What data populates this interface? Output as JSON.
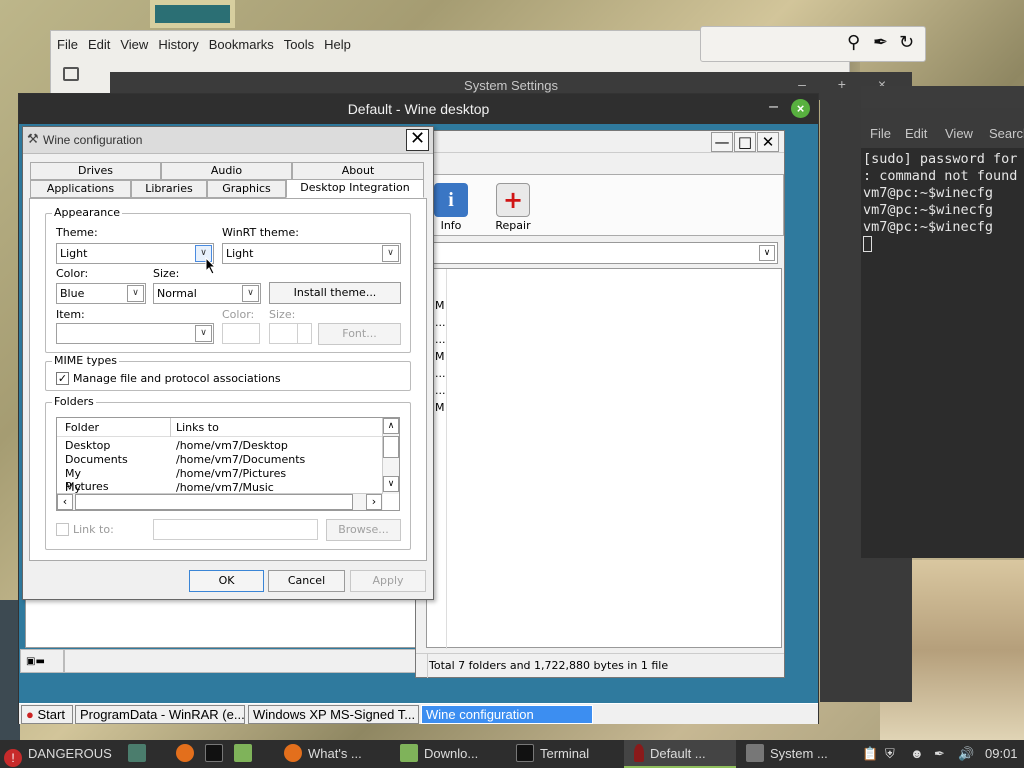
{
  "firefox": {
    "menu": [
      "File",
      "Edit",
      "View",
      "History",
      "Bookmarks",
      "Tools",
      "Help"
    ]
  },
  "system_settings": {
    "title": "System Settings"
  },
  "terminal": {
    "menu": [
      "File",
      "Edit",
      "View",
      "Search"
    ],
    "lines": [
      "[sudo] password for",
      ": command not found",
      "vm7@pc:~$winecfg",
      "vm7@pc:~$winecfg",
      "vm7@pc:~$winecfg"
    ]
  },
  "wine_desktop": {
    "title": "Default - Wine desktop",
    "close_icon": "×",
    "minimize_icon": "–"
  },
  "winrar": {
    "toolbar": [
      {
        "label": "Info",
        "icon": "info-icon"
      },
      {
        "label": "Repair",
        "icon": "repair-icon"
      }
    ],
    "list_fragments": [
      "M",
      "...",
      "...",
      "M",
      "...",
      "...",
      "M"
    ],
    "status": "Total 7 folders and 1,722,880 bytes in 1 file"
  },
  "wine_taskbar": {
    "start": "Start",
    "items": [
      "ProgramData - WinRAR (e...",
      "Windows XP MS-Signed T...",
      "Wine configuration"
    ]
  },
  "winecfg": {
    "title": "Wine configuration",
    "tabs_row1": [
      "Drives",
      "Audio",
      "About"
    ],
    "tabs_row2": [
      "Applications",
      "Libraries",
      "Graphics",
      "Desktop Integration"
    ],
    "appearance": {
      "legend": "Appearance",
      "theme_label": "Theme:",
      "theme_value": "Light",
      "winrt_label": "WinRT theme:",
      "winrt_value": "Light",
      "color_label": "Color:",
      "color_value": "Blue",
      "size_label": "Size:",
      "size_value": "Normal",
      "install_button": "Install theme...",
      "item_label": "Item:",
      "item_value": "",
      "item_color_label": "Color:",
      "item_size_label": "Size:",
      "font_button": "Font..."
    },
    "mime": {
      "legend": "MIME types",
      "manage_label": "Manage file and protocol associations",
      "manage_checked": true
    },
    "folders": {
      "legend": "Folders",
      "col_folder": "Folder",
      "col_links": "Links to",
      "rows": [
        {
          "folder": "Desktop",
          "link": "/home/vm7/Desktop"
        },
        {
          "folder": "Documents",
          "link": "/home/vm7/Documents"
        },
        {
          "folder": "My Pictures",
          "link": "/home/vm7/Pictures"
        },
        {
          "folder": "My Music",
          "link": "/home/vm7/Music"
        }
      ],
      "link_to_label": "Link to:",
      "browse_button": "Browse..."
    },
    "buttons": {
      "ok": "OK",
      "cancel": "Cancel",
      "apply": "Apply"
    }
  },
  "panel": {
    "menu_label": "DANGEROUS",
    "tasks": [
      "What's ...",
      "Downlo...",
      "Terminal",
      "Default ...",
      "System ..."
    ],
    "clock": "09:01"
  }
}
